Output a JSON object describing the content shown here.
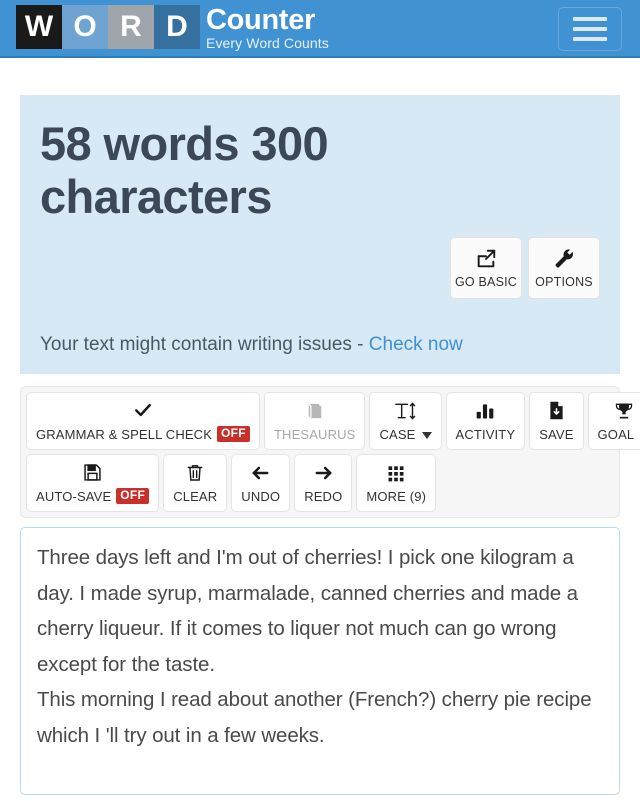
{
  "header": {
    "logo_tiles": [
      "W",
      "O",
      "R",
      "D"
    ],
    "logo_word": "Counter",
    "tagline": "Every Word Counts",
    "menu_icon": "hamburger-menu-icon",
    "bg_color": "#4192d2"
  },
  "count_panel": {
    "summary": "58 words 300 characters",
    "words": 58,
    "characters": 300,
    "bg_color": "#d7e9f4",
    "buttons": [
      {
        "label": "GO BASIC",
        "icon": "external-link-icon"
      },
      {
        "label": "OPTIONS",
        "icon": "wrench-icon"
      }
    ],
    "issues_text": "Your text might contain writing issues - ",
    "issues_link": "Check now",
    "link_color": "#3f90d6"
  },
  "toolbar": {
    "row1": [
      {
        "label": "GRAMMAR & SPELL CHECK",
        "icon": "check-icon",
        "badge": "OFF",
        "disabled": false,
        "caret": false
      },
      {
        "label": "THESAURUS",
        "icon": "book-icon",
        "badge": "",
        "disabled": true,
        "caret": false
      },
      {
        "label": "CASE",
        "icon": "text-height-icon",
        "badge": "",
        "disabled": false,
        "caret": true
      },
      {
        "label": "ACTIVITY",
        "icon": "bar-chart-icon",
        "badge": "",
        "disabled": false,
        "caret": false
      },
      {
        "label": "SAVE",
        "icon": "file-download-icon",
        "badge": "",
        "disabled": false,
        "caret": false
      },
      {
        "label": "GOAL",
        "icon": "trophy-icon",
        "badge": "",
        "disabled": false,
        "caret": true
      }
    ],
    "row2": [
      {
        "label": "AUTO-SAVE",
        "icon": "floppy-disk-icon",
        "badge": "OFF",
        "disabled": false,
        "caret": false
      },
      {
        "label": "CLEAR",
        "icon": "trash-icon",
        "badge": "",
        "disabled": false,
        "caret": false
      },
      {
        "label": "UNDO",
        "icon": "arrow-left-icon",
        "badge": "",
        "disabled": false,
        "caret": false
      },
      {
        "label": "REDO",
        "icon": "arrow-right-icon",
        "badge": "",
        "disabled": false,
        "caret": false
      },
      {
        "label": "MORE (9)",
        "icon": "grid-dots-icon",
        "badge": "",
        "disabled": false,
        "caret": false
      }
    ],
    "badge_color": "#c9302c"
  },
  "editor": {
    "paragraph1": "Three days left and I'm out of cherries! I pick one kilogram a day. I made syrup, marmalade, canned cherries and made a cherry liqueur. If it comes to liquer not much can go wrong except for the taste.",
    "paragraph2": "This morning I read about another (French?) cherry pie recipe which I 'll try out in a few weeks.",
    "border_color": "#b9d8ec"
  }
}
